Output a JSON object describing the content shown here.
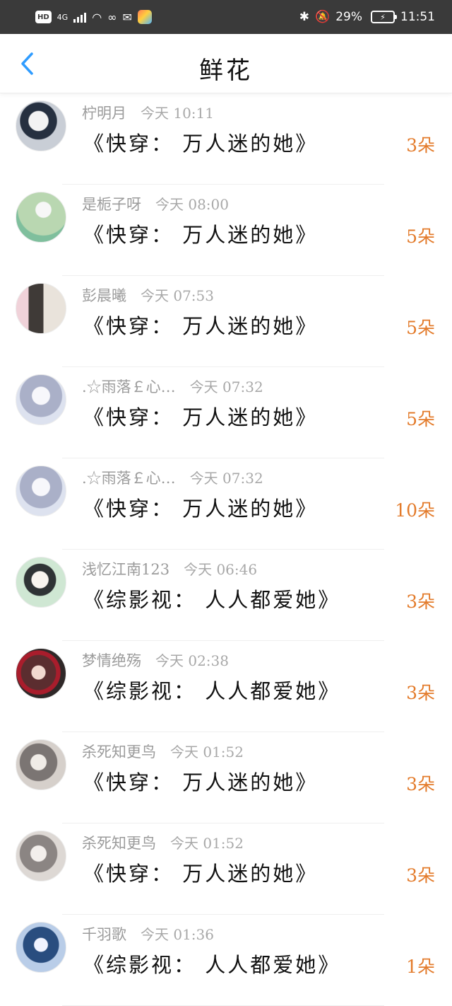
{
  "status_bar": {
    "hd": "HD",
    "network": "4G",
    "battery_percent": "29%",
    "time": "11:51",
    "icons": [
      "signal-icon",
      "wifi-icon",
      "app-icon",
      "chat-icon",
      "colorful-app-icon",
      "bluetooth-icon",
      "mute-icon",
      "battery-charging-icon"
    ]
  },
  "header": {
    "title": "鲜花",
    "back_icon": "back-arrow-icon"
  },
  "colors": {
    "accent_blue": "#2f9cff",
    "flower_count": "#e37b2b",
    "status_bar_bg": "#3a3a3a"
  },
  "items": [
    {
      "user": "柠明月",
      "time": "今天 10:11",
      "book": "《快穿： 万人迷的她》",
      "count": "3朵"
    },
    {
      "user": "是栀子呀",
      "time": "今天 08:00",
      "book": "《快穿： 万人迷的她》",
      "count": "5朵"
    },
    {
      "user": "彭晨曦",
      "time": "今天 07:53",
      "book": "《快穿： 万人迷的她》",
      "count": "5朵"
    },
    {
      "user": ".☆雨落￡心…",
      "time": "今天 07:32",
      "book": "《快穿： 万人迷的她》",
      "count": "5朵"
    },
    {
      "user": ".☆雨落￡心…",
      "time": "今天 07:32",
      "book": "《快穿： 万人迷的她》",
      "count": "10朵"
    },
    {
      "user": "浅忆江南123",
      "time": "今天 06:46",
      "book": "《综影视： 人人都爱她》",
      "count": "3朵"
    },
    {
      "user": "梦情绝殇",
      "time": "今天 02:38",
      "book": "《综影视： 人人都爱她》",
      "count": "3朵"
    },
    {
      "user": "杀死知更鸟",
      "time": "今天 01:52",
      "book": "《快穿： 万人迷的她》",
      "count": "3朵"
    },
    {
      "user": "杀死知更鸟",
      "time": "今天 01:52",
      "book": "《快穿： 万人迷的她》",
      "count": "3朵"
    },
    {
      "user": "千羽歌",
      "time": "今天 01:36",
      "book": "《综影视： 人人都爱她》",
      "count": "1朵"
    }
  ]
}
